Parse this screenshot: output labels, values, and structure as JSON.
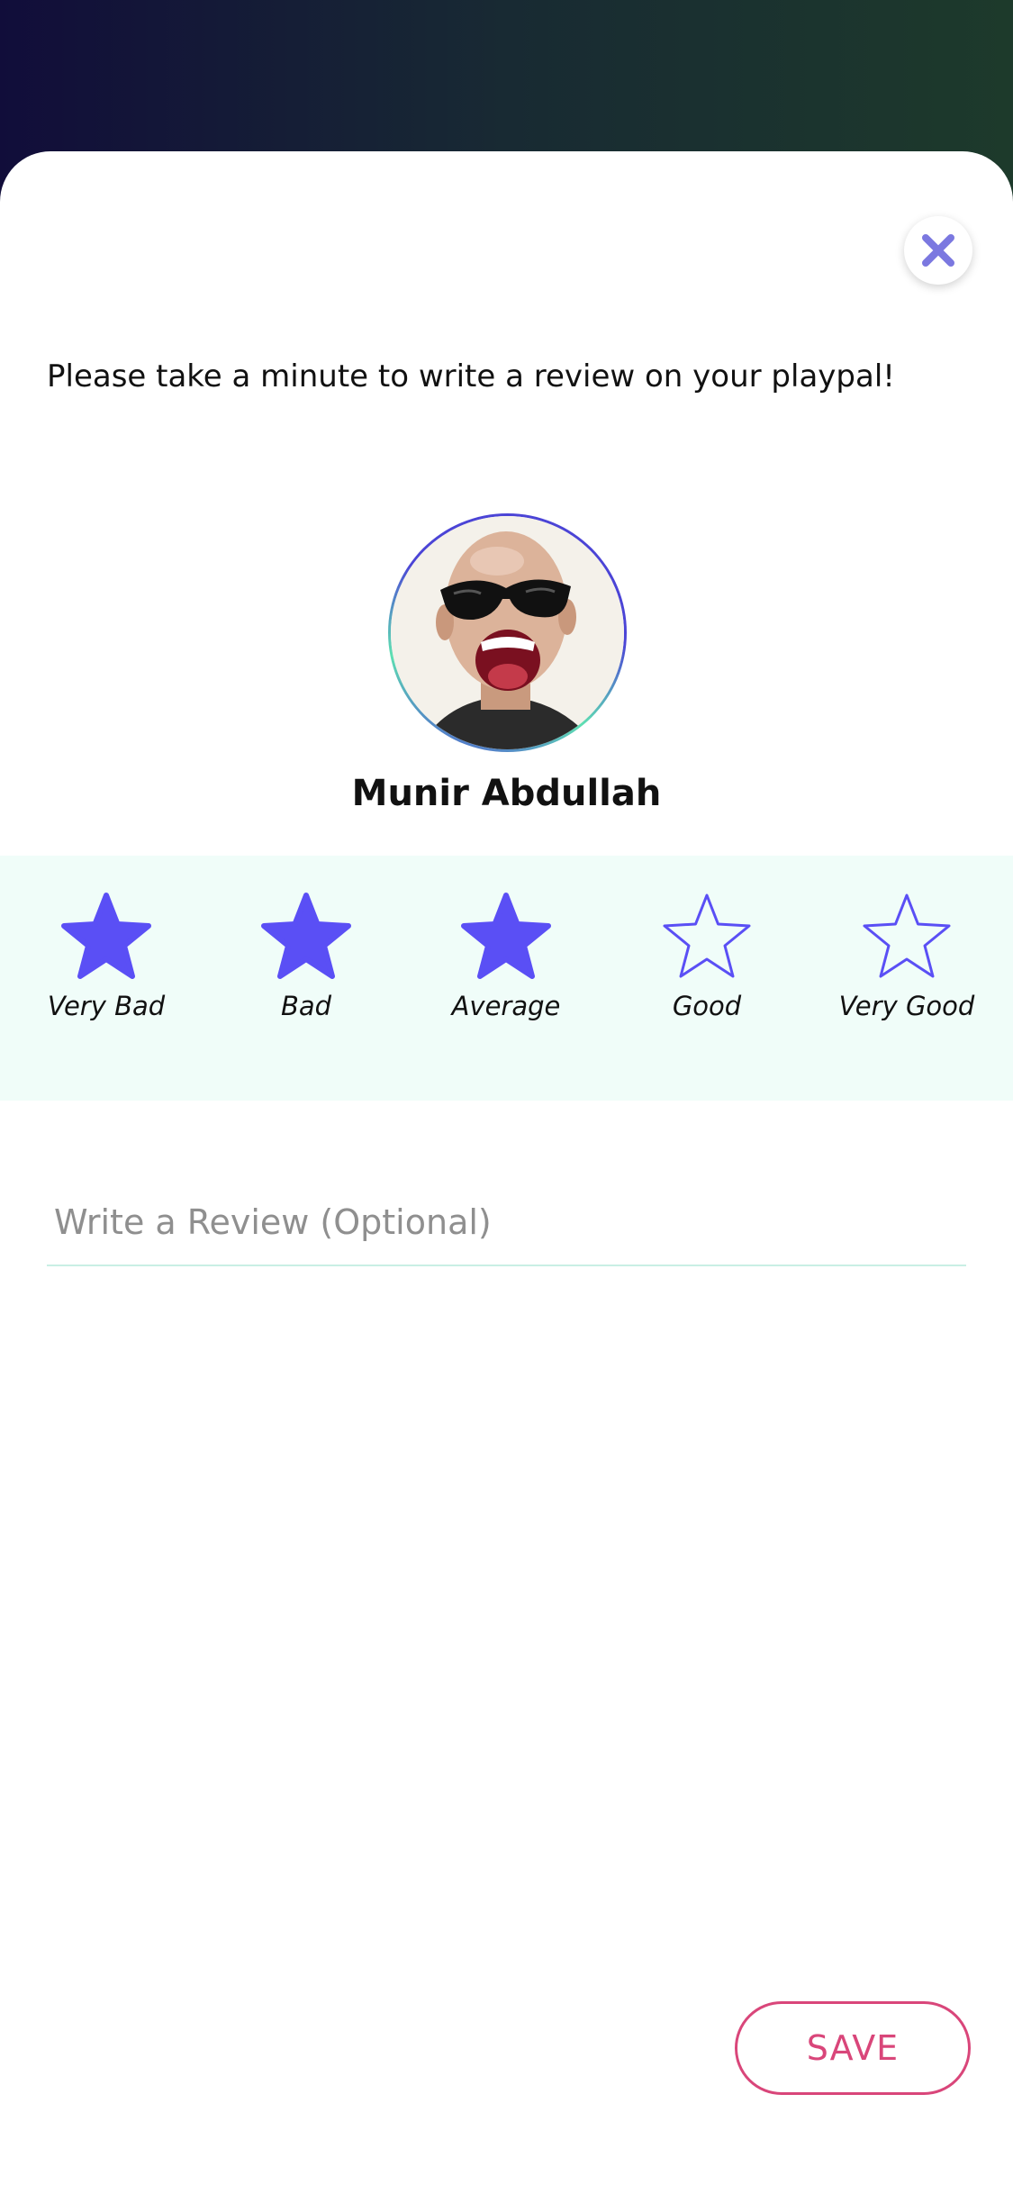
{
  "prompt_text": "Please take a minute to write a review on your playpal!",
  "profile": {
    "name": "Munir Abdullah",
    "avatar_icon": "avatar-photo"
  },
  "rating": {
    "selected": 3,
    "options": [
      {
        "label": "Very Bad"
      },
      {
        "label": "Bad"
      },
      {
        "label": "Average"
      },
      {
        "label": "Good"
      },
      {
        "label": "Very Good"
      }
    ]
  },
  "review": {
    "placeholder": "Write a Review (Optional)",
    "value": ""
  },
  "actions": {
    "save_label": "SAVE"
  },
  "colors": {
    "star": "#5a4ff5",
    "close": "#7b78e0",
    "save": "#d9467a",
    "band": "#f0fdf9"
  }
}
